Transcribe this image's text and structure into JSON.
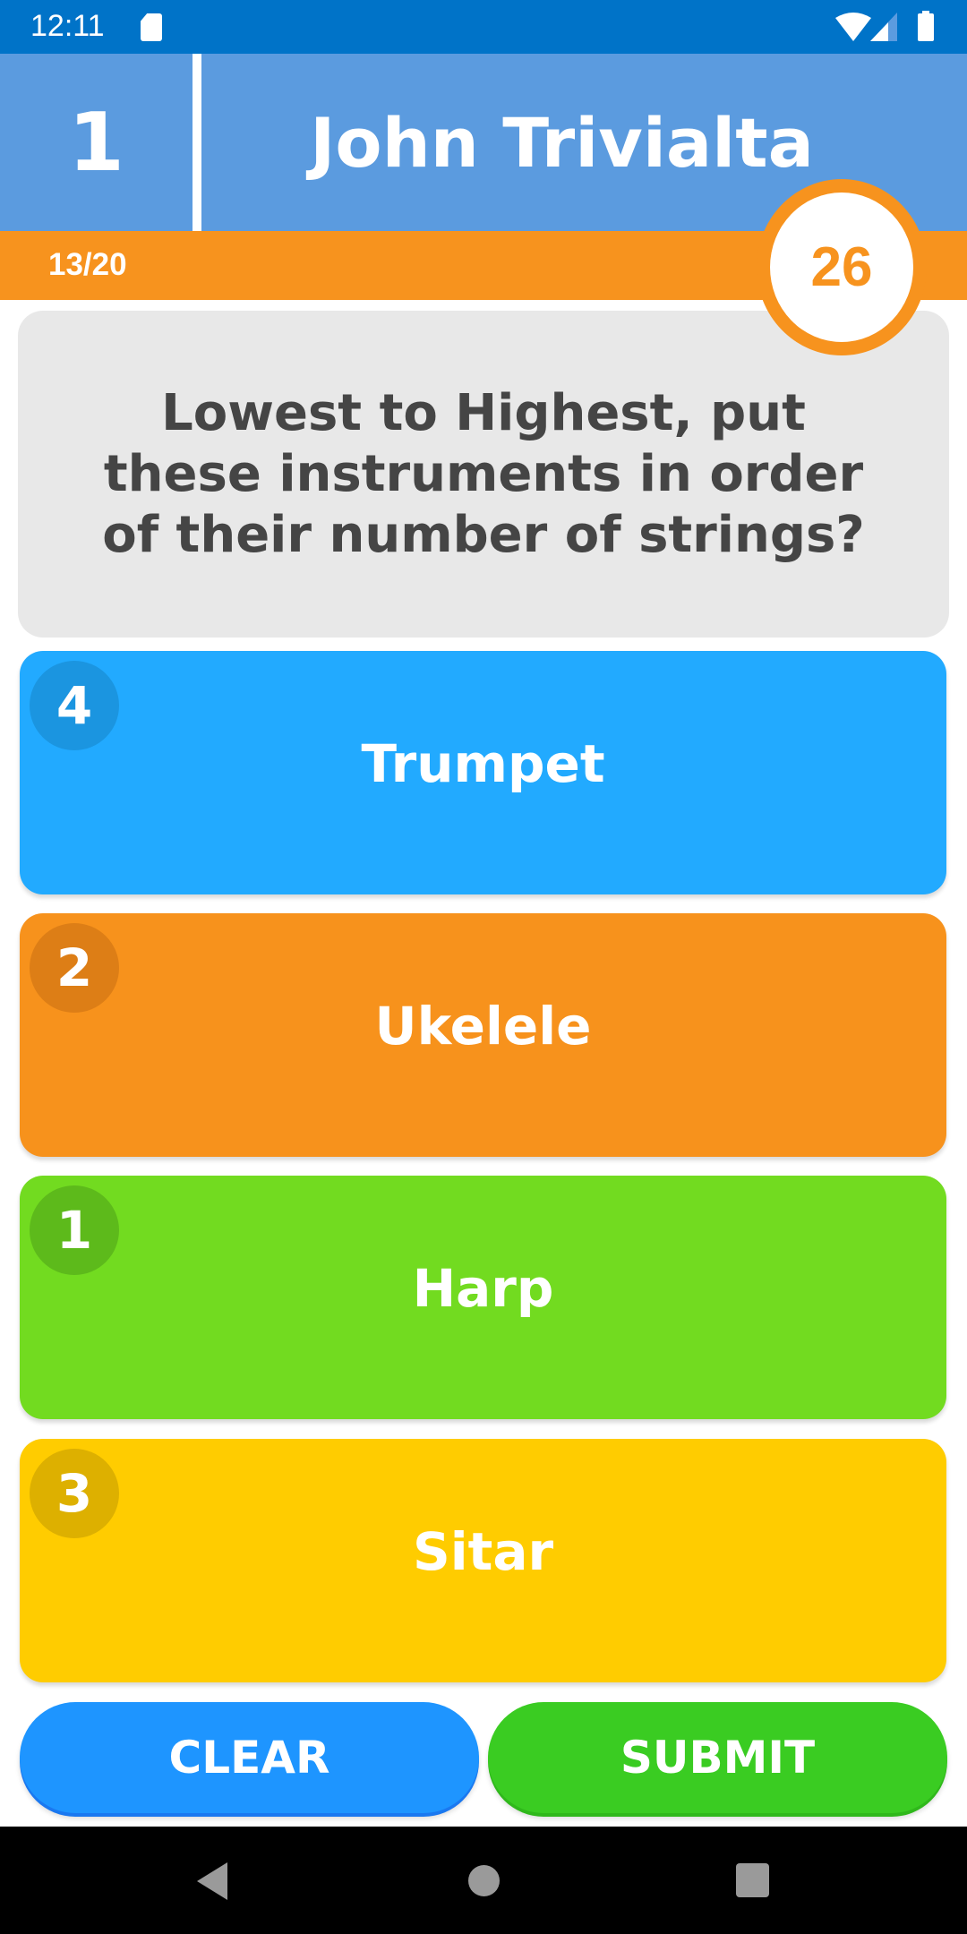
{
  "status_bar": {
    "time": "12:11",
    "icons": [
      "sd-card-icon",
      "wifi-icon",
      "signal-icon",
      "battery-icon"
    ]
  },
  "header": {
    "rank": "1",
    "player_name": "John Trivialta"
  },
  "progress": {
    "question_count": "13/20",
    "current": 13,
    "total": 20
  },
  "score": {
    "value": "26"
  },
  "question": {
    "text": "Lowest to Highest, put these instruments in order of their number of strings?"
  },
  "answers": [
    {
      "order": "4",
      "label": "Trumpet",
      "color": "#22AAFF",
      "badge_color": "#1B95E0"
    },
    {
      "order": "2",
      "label": "Ukelele",
      "color": "#F7921C",
      "badge_color": "#DD7E16"
    },
    {
      "order": "1",
      "label": "Harp",
      "color": "#72DB20",
      "badge_color": "#5DBA1B"
    },
    {
      "order": "3",
      "label": "Sitar",
      "color": "#FFCC00",
      "badge_color": "#DDB000"
    }
  ],
  "buttons": {
    "clear_label": "CLEAR",
    "submit_label": "SUBMIT"
  },
  "colors": {
    "status_bar": "#0073C8",
    "header": "#5B9BDF",
    "accent_orange": "#F7931E",
    "question_bg": "#E8E8E8",
    "question_text": "#454545",
    "clear_button": "#1E95FF",
    "submit_button": "#3ACC22"
  },
  "nav_bar": {
    "buttons": [
      "back-icon",
      "home-icon",
      "recents-icon"
    ]
  }
}
